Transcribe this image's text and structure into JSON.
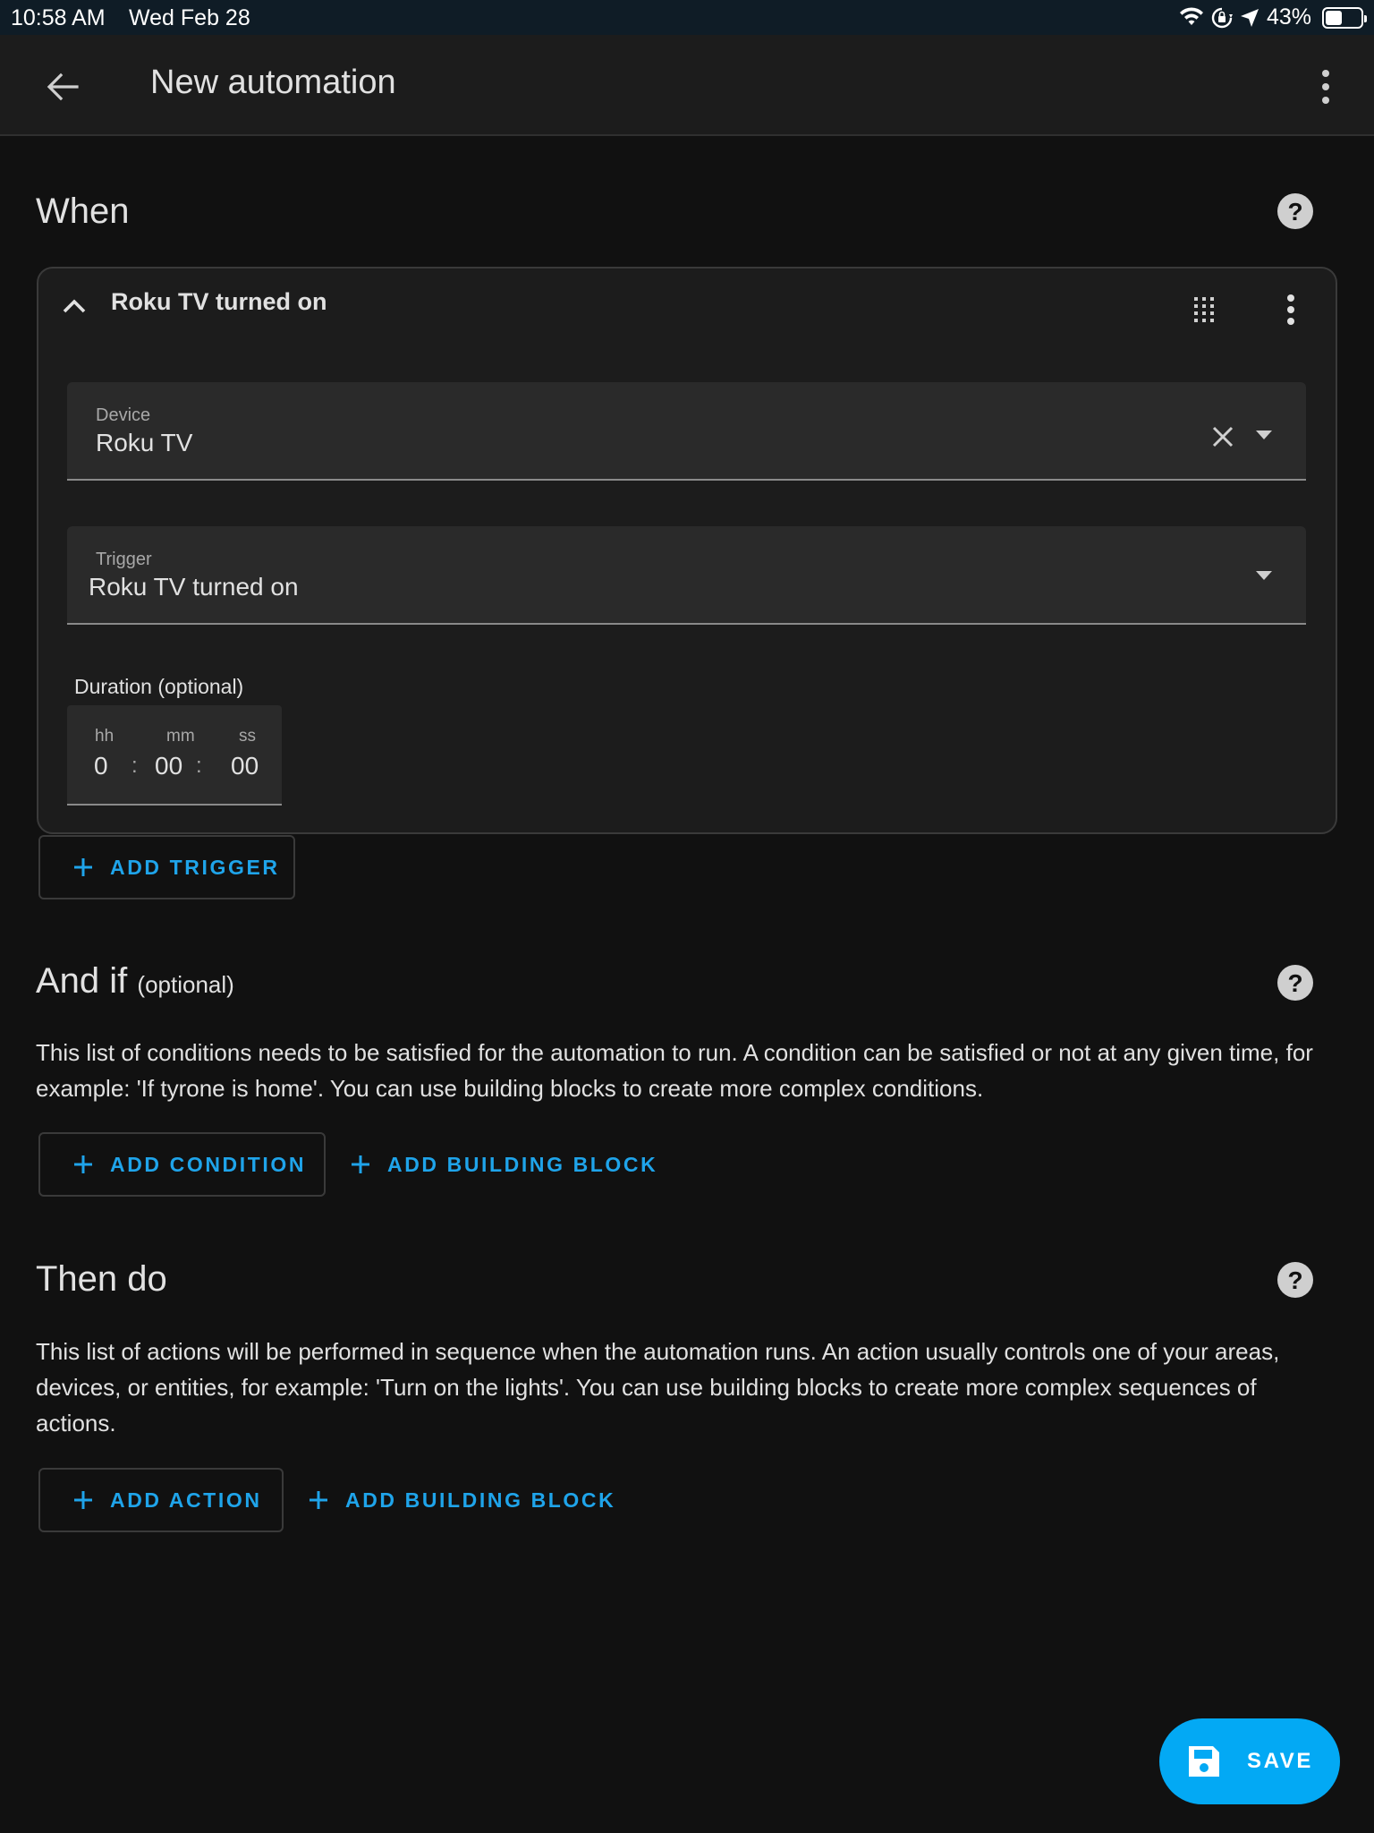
{
  "status_bar": {
    "time": "10:58 AM",
    "date": "Wed Feb 28",
    "battery": "43%",
    "battery_level": 0.43,
    "icons": [
      "wifi-icon",
      "orientation-lock-icon",
      "location-icon",
      "battery-icon"
    ]
  },
  "app_bar": {
    "title": "New automation",
    "icons": [
      "back-arrow-icon",
      "more-vert-icon"
    ]
  },
  "when": {
    "title": "When",
    "trigger_card": {
      "header": "Roku TV turned on",
      "device_label": "Device",
      "device_value": "Roku TV",
      "trigger_label": "Trigger",
      "trigger_value": "Roku TV turned on",
      "duration_label": "Duration (optional)",
      "duration": {
        "hh_label": "hh",
        "mm_label": "mm",
        "ss_label": "ss",
        "hh": "0",
        "mm": "00",
        "ss": "00",
        "sep": ":"
      }
    },
    "add_trigger": "ADD TRIGGER"
  },
  "and_if": {
    "title": "And if",
    "optional": "(optional)",
    "description": "This list of conditions needs to be satisfied for the automation to run. A condition can be satisfied or not at any given time, for example: 'If tyrone is home'. You can use building blocks to create more complex conditions.",
    "add_condition": "ADD CONDITION",
    "add_building_block": "ADD BUILDING BLOCK"
  },
  "then_do": {
    "title": "Then do",
    "description": "This list of actions will be performed in sequence when the automation runs. An action usually controls one of your areas, devices, or entities, for example: 'Turn on the lights'. You can use building blocks to create more complex sequences of actions.",
    "add_action": "ADD ACTION",
    "add_building_block": "ADD BUILDING BLOCK"
  },
  "fab": {
    "label": "SAVE"
  },
  "colors": {
    "accent": "#1fa4ea",
    "fab": "#03a9f4",
    "background": "#111111",
    "card": "#1c1c1c"
  }
}
